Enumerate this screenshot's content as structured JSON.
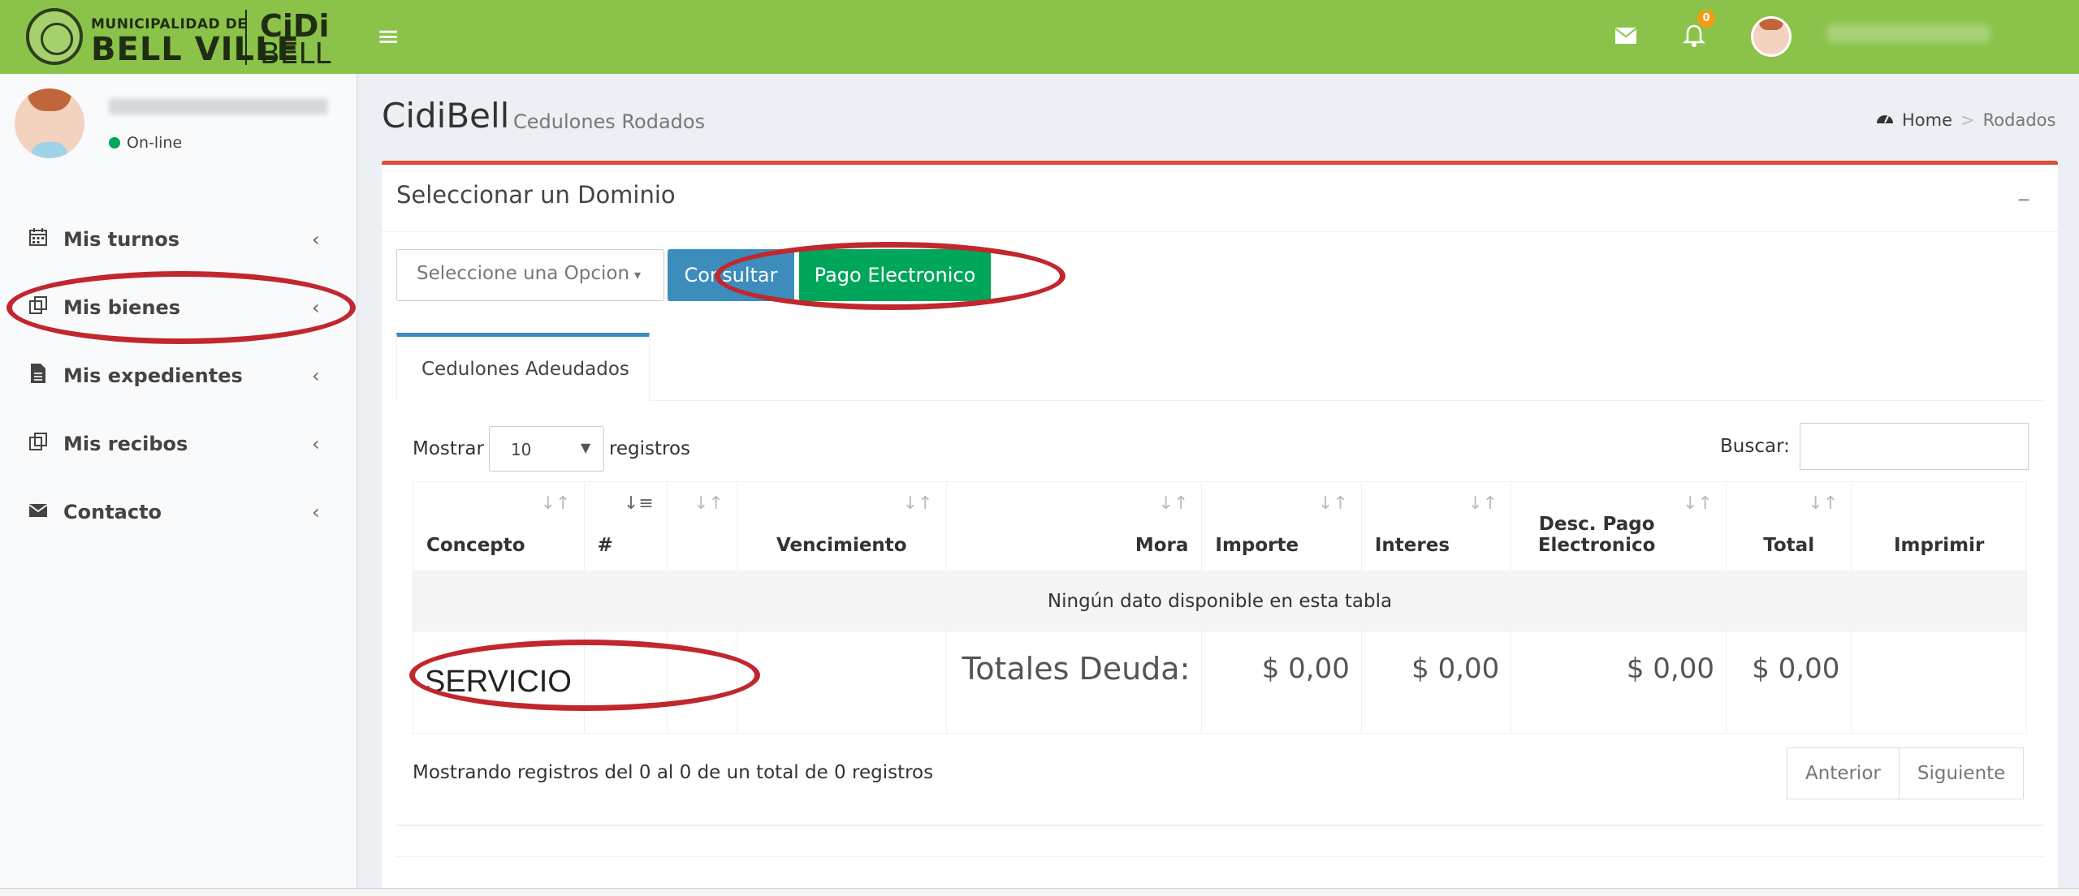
{
  "brand": {
    "municipality_line": "MUNICIPALIDAD DE",
    "city": "BELL VILLE",
    "cidi": "CiDi",
    "bell": "BELL"
  },
  "topbar": {
    "notifications_count": "0",
    "icons": [
      "menu-icon",
      "mail-icon",
      "bell-icon",
      "user-avatar"
    ]
  },
  "sidebar": {
    "user_status": "On-line",
    "items": [
      {
        "label": "Mis turnos",
        "icon": "calendar-icon"
      },
      {
        "label": "Mis bienes",
        "icon": "clone-icon"
      },
      {
        "label": "Mis expedientes",
        "icon": "file-icon"
      },
      {
        "label": "Mis recibos",
        "icon": "clone-icon"
      },
      {
        "label": "Contacto",
        "icon": "envelope-icon"
      }
    ]
  },
  "header": {
    "title": "CidiBell",
    "subtitle": "Cedulones Rodados",
    "breadcrumb_home": "Home",
    "breadcrumb_sep": ">",
    "breadcrumb_current": "Rodados"
  },
  "box": {
    "title": "Seleccionar un Dominio",
    "select_placeholder": "Seleccione una Opcion",
    "consultar": "Consultar",
    "pago": "Pago Electronico",
    "tab": "Cedulones Adeudados"
  },
  "table": {
    "mostrar": "Mostrar",
    "length_value": "10",
    "registros": "registros",
    "buscar": "Buscar:",
    "headers": [
      "Concepto",
      "#",
      "",
      "Vencimiento",
      "Mora",
      "Importe",
      "Interes",
      "Desc. Pago Electronico",
      "Total",
      "Imprimir"
    ],
    "empty_message": "Ningún dato disponible en esta tabla",
    "totals_row": {
      "concepto": "SERVICIO",
      "label": "Totales Deuda:",
      "importe": "$ 0,00",
      "interes": "$ 0,00",
      "desc": "$ 0,00",
      "total": "$ 0,00"
    },
    "info": "Mostrando registros del 0 al 0 de un total de 0 registros",
    "prev": "Anterior",
    "next": "Siguiente"
  },
  "colors": {
    "topbar": "#8bc34a",
    "primary": "#3c8dbc",
    "success": "#00a65a",
    "danger": "#dd4b39",
    "annotation": "#c1272d"
  }
}
